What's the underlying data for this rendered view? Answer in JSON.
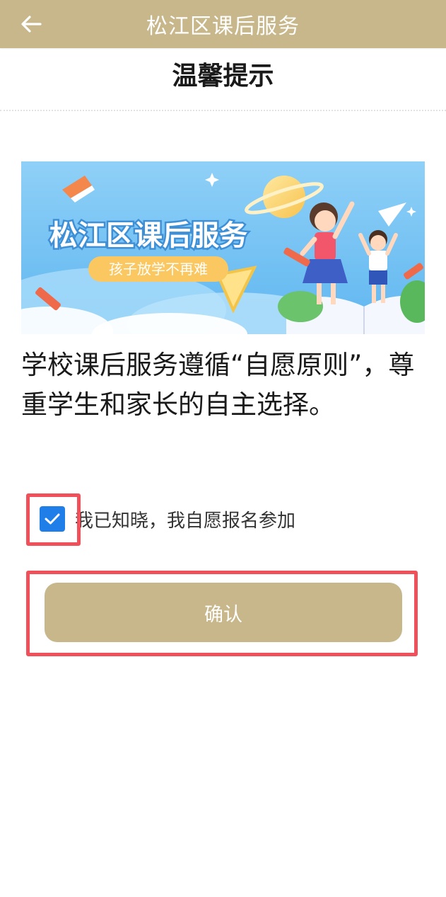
{
  "header": {
    "title": "松江区课后服务",
    "back_icon": "arrow-left-icon"
  },
  "notice": {
    "title": "温馨提示"
  },
  "banner": {
    "title": "松江区课后服务",
    "slogan": "孩子放学不再难"
  },
  "content": {
    "text": "学校课后服务遵循“自愿原则”，尊重学生和家长的自主选择。"
  },
  "agreement": {
    "checked": true,
    "label": "我已知晓，我自愿报名参加"
  },
  "actions": {
    "confirm_label": "确认"
  },
  "colors": {
    "header_bg": "#c8b78a",
    "button_bg": "#c8b78a",
    "checkbox": "#1f7ee8",
    "highlight": "#ef5059"
  }
}
